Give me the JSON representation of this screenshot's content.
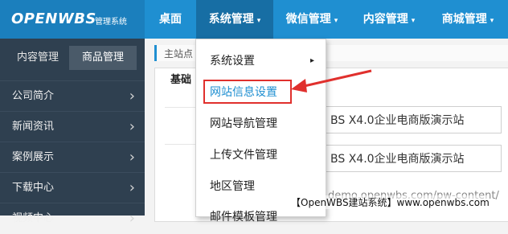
{
  "logo": {
    "main": "OPENWBS",
    "sub": "管理系统"
  },
  "nav": {
    "items": [
      {
        "label": "桌面",
        "has_caret": false
      },
      {
        "label": "系统管理",
        "has_caret": true
      },
      {
        "label": "微信管理",
        "has_caret": true
      },
      {
        "label": "内容管理",
        "has_caret": true
      },
      {
        "label": "商城管理",
        "has_caret": true
      }
    ],
    "caret": "▾"
  },
  "sidebar": {
    "tabs": [
      "内容管理",
      "商品管理"
    ],
    "items": [
      {
        "label": "公司简介",
        "arrow": "›"
      },
      {
        "label": "新闻资讯",
        "arrow": "›"
      },
      {
        "label": "案例展示",
        "arrow": "›"
      },
      {
        "label": "下载中心",
        "arrow": "›"
      },
      {
        "label": "视频中心",
        "arrow": "›"
      }
    ]
  },
  "main": {
    "breadcrumb": "主站点",
    "tab_basic": "基础",
    "field1_value": "BS X4.0企业电商版演示站",
    "field2_value": "BS X4.0企业电商版演示站",
    "url_text": "demo.openwbs.com/pw-content/"
  },
  "dropdown": {
    "items": [
      {
        "label": "系统设置",
        "submenu_arrow": "▸"
      },
      {
        "label": "网站信息设置"
      },
      {
        "label": "网站导航管理"
      },
      {
        "label": "上传文件管理"
      },
      {
        "label": "地区管理"
      },
      {
        "label": "邮件模板管理"
      }
    ]
  },
  "watermark": "【OpenWBS建站系统】www.openwbs.com",
  "colors": {
    "topbar": "#1f8fd1",
    "sidebar": "#2f4050",
    "highlight_red": "#e0302d",
    "link_blue": "#1f8fd1"
  }
}
